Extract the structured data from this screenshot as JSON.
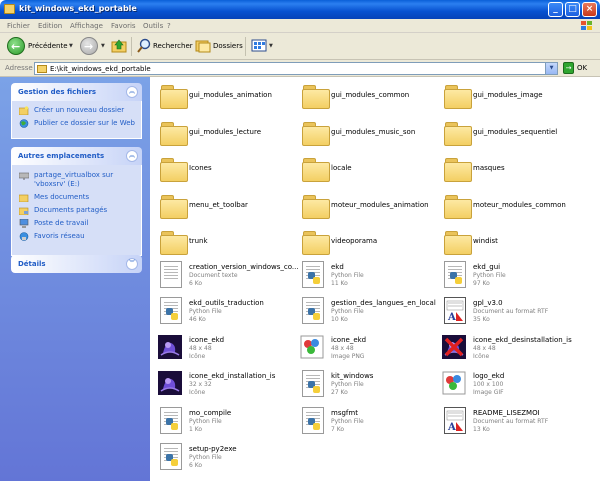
{
  "window": {
    "title": "kit_windows_ekd_portable",
    "minimize": "_",
    "maximize": "□",
    "close": "×"
  },
  "menu": [
    "Fichier",
    "Edition",
    "Affichage",
    "Favoris",
    "Outils",
    "?"
  ],
  "toolbar": {
    "back": "Précédente",
    "search": "Rechercher",
    "folders": "Dossiers"
  },
  "address": {
    "label": "Adresse",
    "value": "E:\\kit_windows_ekd_portable",
    "go": "OK"
  },
  "sidebar": {
    "file_tasks": {
      "title": "Gestion des fichiers",
      "items": [
        "Créer un nouveau dossier",
        "Publier ce dossier sur le Web"
      ]
    },
    "other_places": {
      "title": "Autres emplacements",
      "items": [
        "partage_virtualbox sur 'vboxsrv' (E:)",
        "Mes documents",
        "Documents partagés",
        "Poste de travail",
        "Favoris réseau"
      ]
    },
    "details": {
      "title": "Détails"
    }
  },
  "folders": [
    "gui_modules_animation",
    "gui_modules_common",
    "gui_modules_image",
    "gui_modules_lecture",
    "gui_modules_music_son",
    "gui_modules_sequentiel",
    "Icones",
    "locale",
    "masques",
    "menu_et_toolbar",
    "moteur_modules_animation",
    "moteur_modules_common",
    "trunk",
    "videoporama",
    "windist"
  ],
  "files": [
    {
      "name": "creation_version_windows_co...",
      "type": "Document texte",
      "size": "6 Ko",
      "icon": "text"
    },
    {
      "name": "ekd",
      "type": "Python File",
      "size": "11 Ko",
      "icon": "python"
    },
    {
      "name": "ekd_gui",
      "type": "Python File",
      "size": "97 Ko",
      "icon": "python"
    },
    {
      "name": "ekd_outils_traduction",
      "type": "Python File",
      "size": "46 Ko",
      "icon": "python"
    },
    {
      "name": "gestion_des_langues_en_local",
      "type": "Python File",
      "size": "10 Ko",
      "icon": "python"
    },
    {
      "name": "gpl_v3.0",
      "type": "Document au format RTF",
      "size": "35 Ko",
      "icon": "rtf"
    },
    {
      "name": "icone_ekd",
      "type": "48 x 48",
      "size": "Icône",
      "icon": "ico"
    },
    {
      "name": "icone_ekd",
      "type": "48 x 48",
      "size": "Image PNG",
      "icon": "png"
    },
    {
      "name": "icone_ekd_desinstallation_is",
      "type": "48 x 48",
      "size": "Icône",
      "icon": "ico-x"
    },
    {
      "name": "icone_ekd_installation_is",
      "type": "32 x 32",
      "size": "Icône",
      "icon": "ico"
    },
    {
      "name": "kit_windows",
      "type": "Python File",
      "size": "27 Ko",
      "icon": "python"
    },
    {
      "name": "logo_ekd",
      "type": "100 x 100",
      "size": "Image GIF",
      "icon": "png"
    },
    {
      "name": "mo_compile",
      "type": "Python File",
      "size": "1 Ko",
      "icon": "python"
    },
    {
      "name": "msgfmt",
      "type": "Python File",
      "size": "7 Ko",
      "icon": "python"
    },
    {
      "name": "README_LISEZMOI",
      "type": "Document au format RTF",
      "size": "13 Ko",
      "icon": "rtf"
    },
    {
      "name": "setup-py2exe",
      "type": "Python File",
      "size": "6 Ko",
      "icon": "python"
    }
  ]
}
